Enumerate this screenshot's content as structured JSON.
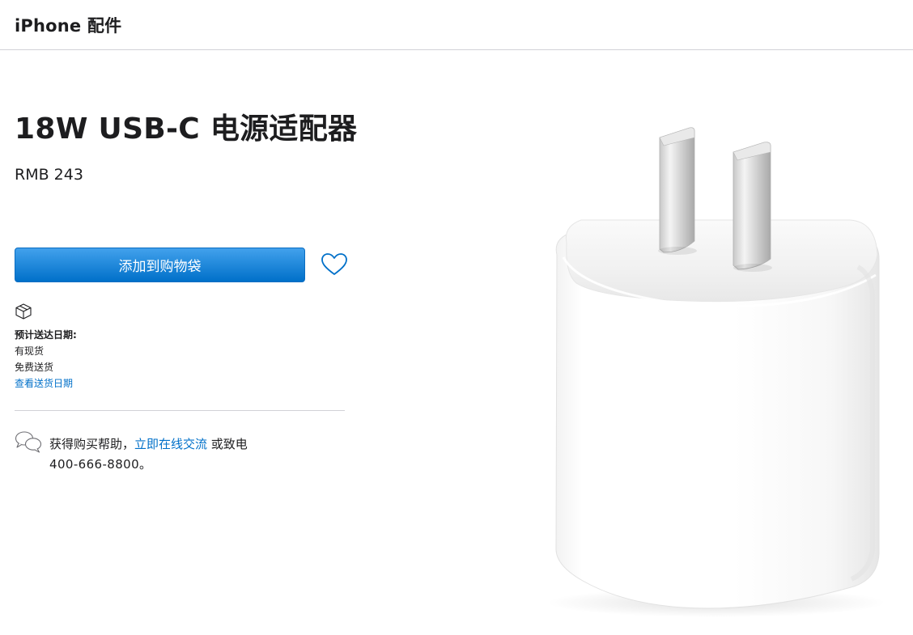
{
  "header": {
    "title": "iPhone 配件"
  },
  "product": {
    "title": "18W USB-C 电源适配器",
    "price": "RMB 243",
    "add_to_bag_label": "添加到购物袋",
    "image_icon": "power-adapter-image"
  },
  "delivery": {
    "icon": "box-icon",
    "label": "预计送达日期:",
    "availability": "有现货",
    "shipping": "免费送货",
    "check_link": "查看送货日期"
  },
  "help": {
    "icon": "chat-bubbles-icon",
    "prefix": "获得购买帮助，",
    "link": "立即在线交流",
    "suffix": " 或致电",
    "phone": "400-666-8800。"
  },
  "colors": {
    "accent": "#0070c9",
    "button_top": "#42a1ec",
    "button_bottom": "#0070c9",
    "text": "#1d1d1f",
    "divider": "#d2d2d7"
  }
}
